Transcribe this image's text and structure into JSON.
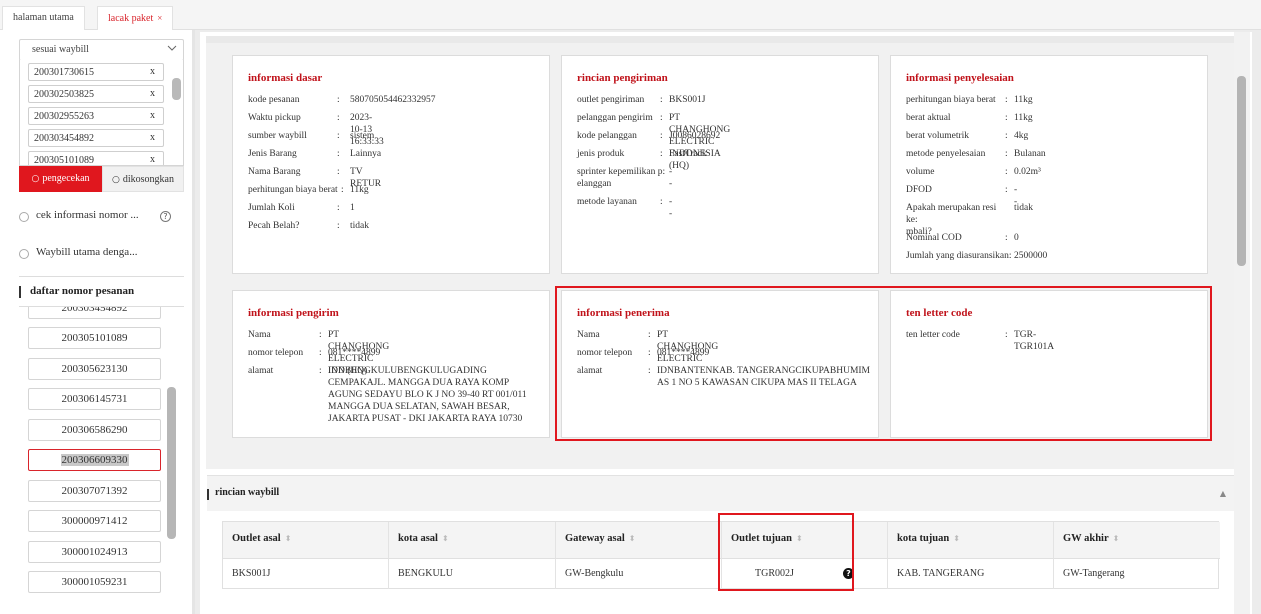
{
  "tabs": [
    {
      "label": "halaman utama"
    },
    {
      "label": "lacak paket",
      "close": "×"
    }
  ],
  "left": {
    "select_value": "sesuai waybill",
    "waybills": [
      "200301730615",
      "200302503825",
      "200302955263",
      "200303454892",
      "200305101089"
    ],
    "remove_glyph": "x",
    "search_label": "pengecekan",
    "clear_label": "dikosongkan",
    "radio_1": "cek informasi nomor ...",
    "radio_2": "Waybill utama denga...",
    "order_header": "daftar nomor pesanan",
    "orders": [
      "200303454892",
      "200305101089",
      "200305623130",
      "200306145731",
      "200306586290",
      "200306609330",
      "200307071392",
      "300000971412",
      "300001024913",
      "300001059231"
    ],
    "active_order": "200306609330"
  },
  "cards": {
    "dasar": {
      "title": "informasi dasar",
      "rows": [
        {
          "k": "kode pesanan",
          "v": "580705054462332957"
        },
        {
          "k": "Waktu pickup",
          "v": "2023-10-13 16:33:33"
        },
        {
          "k": "sumber waybill",
          "v": "sistem"
        },
        {
          "k": "Jenis Barang",
          "v": "Lainnya"
        },
        {
          "k": "Nama Barang",
          "v": "TV RETUR"
        },
        {
          "k": "perhitungan biaya berat",
          "v": "11kg"
        },
        {
          "k": "Jumlah Koli",
          "v": "1"
        },
        {
          "k": "Pecah Belah?",
          "v": "tidak"
        }
      ]
    },
    "pengiriman": {
      "title": "rincian pengiriman",
      "rows": [
        {
          "k": "outlet pengiriman",
          "v": "BKS001J"
        },
        {
          "k": "pelanggan pengirim",
          "v": "PT CHANGHONG ELECTRIC INDONESIA (HQ)"
        },
        {
          "k": "kode pelanggan",
          "v": "J0086028692"
        },
        {
          "k": "jenis produk",
          "v": "FastTrack"
        },
        {
          "k": "sprinter kepemilikan p:\nelanggan",
          "v": "--"
        },
        {
          "k": "metode layanan",
          "v": "--"
        }
      ]
    },
    "penyelesaian": {
      "title": "informasi penyelesaian",
      "rows": [
        {
          "k": "perhitungan biaya berat",
          "v": "11kg"
        },
        {
          "k": "berat aktual",
          "v": "11kg"
        },
        {
          "k": "berat volumetrik",
          "v": "4kg"
        },
        {
          "k": "metode penyelesaian",
          "v": "Bulanan"
        },
        {
          "k": "volume",
          "v": "0.02m³"
        },
        {
          "k": "DFOD",
          "v": "--"
        },
        {
          "k": "Apakah merupakan resi ke:\nmbali?",
          "v": "tidak"
        },
        {
          "k": "Nominal COD",
          "v": "0"
        },
        {
          "k": "Jumlah yang diasuransikan:",
          "v": "2500000"
        }
      ]
    },
    "pengirim": {
      "title": "informasi pengirim",
      "rows": [
        {
          "k": "Nama",
          "v": "PT CHANGHONG ELECTRIC IND (HQ)"
        },
        {
          "k": "nomor telepon",
          "v": "081****4899"
        },
        {
          "k": "alamat",
          "v": "IDNBENGKULUBENGKULUGADING CEMPAKAJL. MANGGA DUA RAYA KOMP AGUNG SEDAYU BLO K J NO 39-40 RT 001/011 MANGGA DUA SELATAN, SAWAH BESAR, JAKARTA PUSAT - DKI JAKARTA RAYA 10730"
        }
      ]
    },
    "penerima": {
      "title": "informasi penerima",
      "rows": [
        {
          "k": "Nama",
          "v": "PT CHANGHONG ELECTRIC"
        },
        {
          "k": "nomor telepon",
          "v": "081****4899"
        },
        {
          "k": "alamat",
          "v": "IDNBANTENKAB. TANGERANGCIKUPABHUMIM AS 1 NO 5 KAWASAN CIKUPA MAS II TELAGA"
        }
      ]
    },
    "tlc": {
      "title": "ten letter code",
      "rows": [
        {
          "k": "ten letter code",
          "v": "TGR-TGR101A"
        }
      ]
    }
  },
  "waybill_section": {
    "title": "rincian waybill",
    "columns": [
      "Outlet asal",
      "kota asal",
      "Gateway asal",
      "Outlet tujuan",
      "kota tujuan",
      "GW akhir"
    ],
    "row": [
      "BKS001J",
      "BENGKULU",
      "GW-Bengkulu",
      "TGR002J",
      "KAB. TANGERANG",
      "GW-Tangerang"
    ],
    "sort_glyph": "⬍",
    "help_glyph": "?"
  },
  "colors": {
    "accent": "#e0171e",
    "title_red": "#c0121a"
  }
}
